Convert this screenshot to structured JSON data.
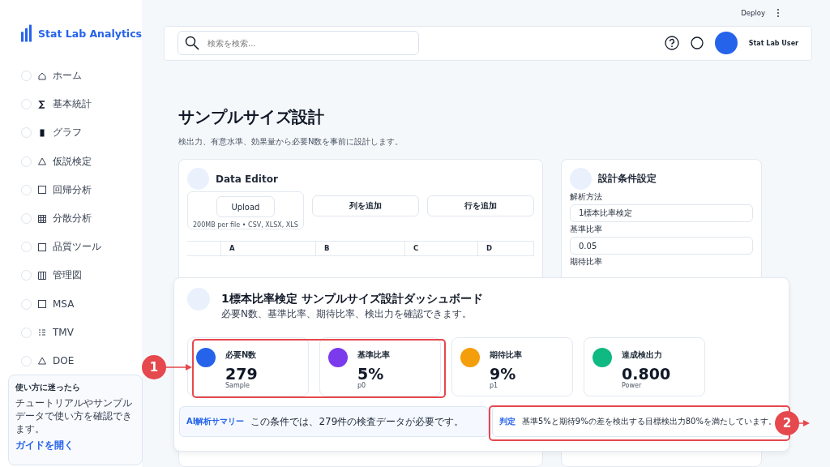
{
  "app": {
    "name": "Stat Lab Analytics"
  },
  "sidebar": {
    "items": [
      {
        "label": "ホーム"
      },
      {
        "label": "基本統計"
      },
      {
        "label": "グラフ"
      },
      {
        "label": "仮説検定"
      },
      {
        "label": "回帰分析"
      },
      {
        "label": "分散分析"
      },
      {
        "label": "品質ツール"
      },
      {
        "label": "管理図"
      },
      {
        "label": "MSA"
      },
      {
        "label": "TMV"
      },
      {
        "label": "DOE"
      }
    ],
    "guide": {
      "title": "使い方に迷ったら",
      "text": "チュートリアルやサンプルデータで使い方を確認できます。",
      "link": "ガイドを開く"
    }
  },
  "topbar": {
    "deploy": "Deploy",
    "search": {
      "placeholder": "検索を検索..."
    },
    "user": "Stat Lab User"
  },
  "page": {
    "title": "サンプルサイズ設計",
    "subtitle": "検出力、有意水準、効果量から必要N数を事前に設計します。"
  },
  "data_editor": {
    "title": "Data Editor",
    "upload": "Upload",
    "upload_hint": "200MB per file • CSV, XLSX, XLS",
    "buttons": [
      "列を追加",
      "行を追加"
    ],
    "columns": [
      "A",
      "B",
      "C",
      "D"
    ]
  },
  "settings": {
    "title": "設計条件設定",
    "fields": [
      {
        "label": "解析方法",
        "value": "1標本比率検定"
      },
      {
        "label": "基準比率",
        "value": "0.05"
      },
      {
        "label": "期待比率"
      }
    ]
  },
  "dashboard": {
    "title": "1標本比率検定 サンプルサイズ設計ダッシュボード",
    "subtitle": "必要N数、基準比率、期待比率、検出力を確認できます。",
    "kpis": [
      {
        "label": "必要N数",
        "value": "279",
        "caption": "Sample",
        "color": "#2563eb"
      },
      {
        "label": "基準比率",
        "value": "5%",
        "caption": "p0",
        "color": "#7c3aed"
      },
      {
        "label": "期待比率",
        "value": "9%",
        "caption": "p1",
        "color": "#f59e0b"
      },
      {
        "label": "達成検出力",
        "value": "0.800",
        "caption": "Power",
        "color": "#10b981"
      }
    ],
    "summary": {
      "label": "AI解析サマリー",
      "text": "この条件では、279件の検査データが必要です。"
    },
    "verdict": {
      "label": "判定",
      "text": "基準5%と期待9%の差を検出する目標検出力80%を満たしています。"
    }
  },
  "annotations": [
    {
      "number": "1"
    },
    {
      "number": "2"
    }
  ]
}
